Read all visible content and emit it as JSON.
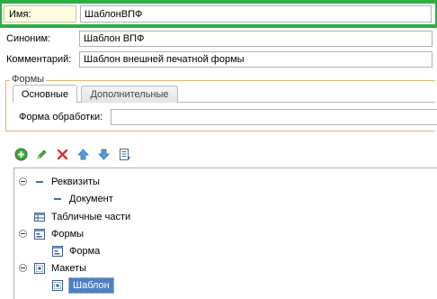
{
  "fields": {
    "name": {
      "label": "Имя:",
      "value": "ШаблонВПФ"
    },
    "synonym": {
      "label": "Синоним:",
      "value": "Шаблон ВПФ"
    },
    "comment": {
      "label": "Комментарий:",
      "value": "Шаблон внешней печатной формы"
    }
  },
  "forms_group": {
    "title": "Формы",
    "tabs": [
      {
        "label": "Основные",
        "active": true
      },
      {
        "label": "Дополнительные",
        "active": false
      }
    ],
    "processing_form": {
      "label": "Форма обработки:",
      "value": ""
    }
  },
  "toolbar": {
    "buttons": [
      "add-icon",
      "edit-icon",
      "delete-icon",
      "move-up-icon",
      "move-down-icon",
      "list-icon"
    ]
  },
  "tree": {
    "nodes": [
      {
        "label": "Реквизиты",
        "level": 0,
        "expandable": true,
        "icon": "attribute-icon"
      },
      {
        "label": "Документ",
        "level": 1,
        "expandable": false,
        "icon": "attribute-icon"
      },
      {
        "label": "Табличные части",
        "level": 0,
        "expandable": false,
        "icon": "table-icon"
      },
      {
        "label": "Формы",
        "level": 0,
        "expandable": true,
        "icon": "form-icon"
      },
      {
        "label": "Форма",
        "level": 1,
        "expandable": false,
        "icon": "form-icon"
      },
      {
        "label": "Макеты",
        "level": 0,
        "expandable": true,
        "icon": "template-icon"
      },
      {
        "label": "Шаблон",
        "level": 1,
        "expandable": false,
        "icon": "template-icon",
        "selected": true
      }
    ]
  },
  "colors": {
    "focus_border": "#2dae45",
    "selection": "#4f7fc2",
    "group_border": "#e0b87a"
  }
}
